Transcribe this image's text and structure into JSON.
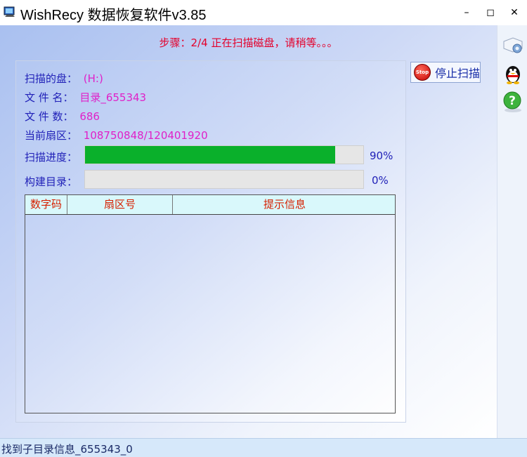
{
  "window": {
    "title": "WishRecy 数据恢复软件v3.85",
    "controls": {
      "minimize": "–",
      "maximize": "◻",
      "close": "✕"
    }
  },
  "step_text": "步骤：2/4 正在扫描磁盘，请稍等。。。",
  "scan_info": {
    "disk_label": "扫描的盘：",
    "disk_value": "(H:)",
    "filename_label": "文 件 名：",
    "filename_value": "目录_655343",
    "file_count_label": "文 件 数：",
    "file_count_value": "686",
    "sector_label": "当前扇区：",
    "sector_value": "108750848/120401920"
  },
  "progress": {
    "scan_label": "扫描进度：",
    "scan_percent_text": "90%",
    "scan_value": 0.9,
    "build_label": "构建目录：",
    "build_percent_text": "0%",
    "build_value": 0.0
  },
  "table": {
    "columns": [
      "数字码",
      "扇区号",
      "提示信息"
    ],
    "rows": []
  },
  "stop_button": {
    "label": "停止扫描",
    "icon_text": "Stop",
    "icon": "stop-sign-icon"
  },
  "sidebar": [
    {
      "icon": "settings-gear-icon"
    },
    {
      "icon": "qq-penguin-icon"
    },
    {
      "icon": "help-question-icon"
    }
  ],
  "status_bar": {
    "text": "找到子目录信息_655343_0"
  },
  "colors": {
    "step_text": "#e4002b",
    "label_text": "#2121b8",
    "value_text": "#e020c8",
    "progress_fill": "#0ab02b",
    "table_header_bg": "#d9f8fb",
    "table_header_text": "#d62000"
  }
}
